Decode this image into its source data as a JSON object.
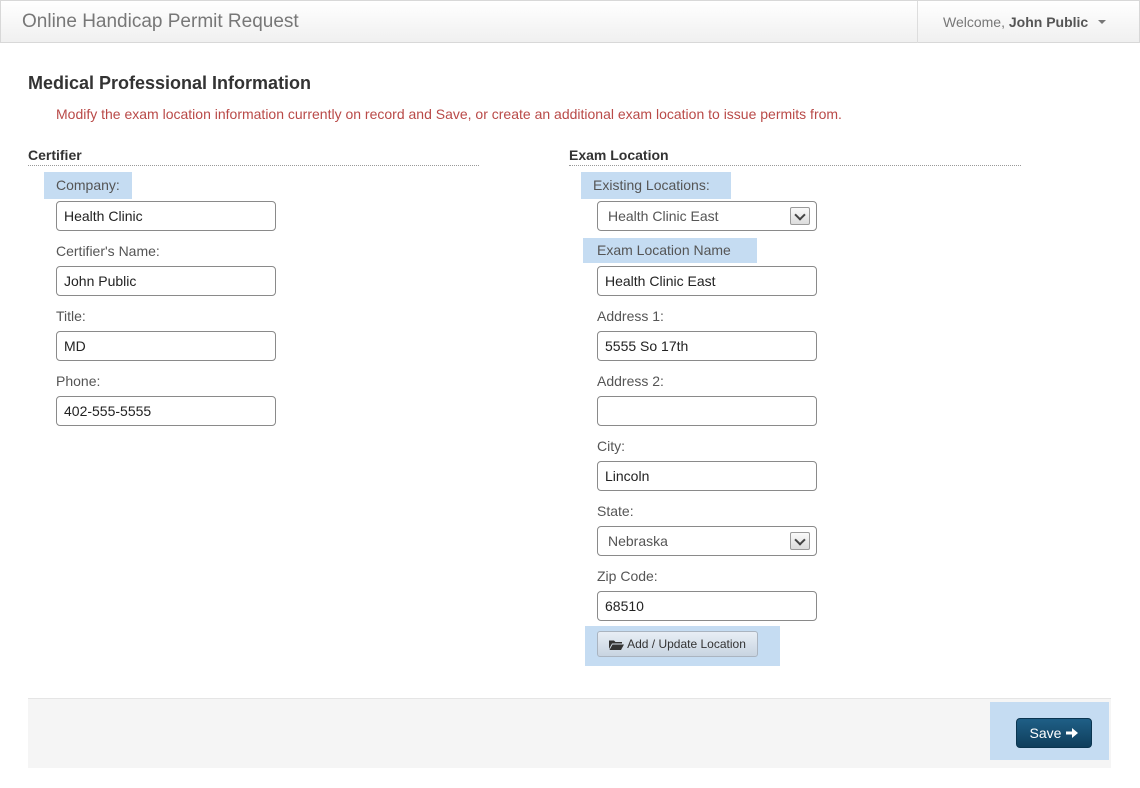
{
  "header": {
    "title": "Online Handicap Permit Request",
    "welcome": "Welcome,",
    "user_name": "John Public"
  },
  "page": {
    "title": "Medical Professional Information",
    "notice": "Modify the exam location information currently on record and Save, or create an additional exam location to issue permits from."
  },
  "certifier": {
    "section_title": "Certifier",
    "company_label": "Company:",
    "company_value": "Health Clinic",
    "name_label": "Certifier's Name:",
    "name_value": "John Public",
    "title_label": "Title:",
    "title_value": "MD",
    "phone_label": "Phone:",
    "phone_value": "402-555-5555"
  },
  "exam_location": {
    "section_title": "Exam Location",
    "existing_label": "Existing Locations:",
    "existing_selected": "Health Clinic East",
    "name_label": "Exam Location Name",
    "name_value": "Health Clinic East",
    "address1_label": "Address 1:",
    "address1_value": "5555 So 17th",
    "address2_label": "Address 2:",
    "address2_value": "",
    "city_label": "City:",
    "city_value": "Lincoln",
    "state_label": "State:",
    "state_selected": "Nebraska",
    "zip_label": "Zip Code:",
    "zip_value": "68510",
    "add_update_label": "Add / Update Location"
  },
  "footer": {
    "save_label": "Save"
  },
  "colors": {
    "highlight": "#c5dcf2",
    "notice": "#b94a48",
    "save_button": "#174f72"
  },
  "icons": {
    "caret": "caret-down-icon",
    "folder": "folder-open-icon",
    "save_arrow": "arrow-right-icon"
  }
}
